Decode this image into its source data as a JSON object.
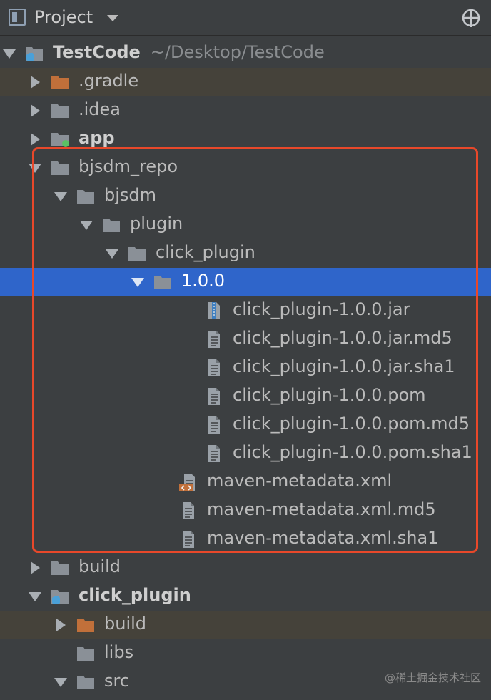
{
  "toolbar": {
    "title": "Project"
  },
  "tree": [
    {
      "label": "TestCode",
      "path": "~/Desktop/TestCode",
      "icon": "module-folder-icon",
      "arrow": "down",
      "bold": true
    },
    {
      "label": ".gradle",
      "icon": "folder-orange-icon",
      "arrow": "right",
      "highlight": true
    },
    {
      "label": ".idea",
      "icon": "folder-icon",
      "arrow": "right"
    },
    {
      "label": "app",
      "icon": "android-module-folder-icon",
      "arrow": "right",
      "bold": true
    },
    {
      "label": "bjsdm_repo",
      "icon": "folder-icon",
      "arrow": "down"
    },
    {
      "label": "bjsdm",
      "icon": "folder-icon",
      "arrow": "down"
    },
    {
      "label": "plugin",
      "icon": "folder-icon",
      "arrow": "down"
    },
    {
      "label": "click_plugin",
      "icon": "folder-icon",
      "arrow": "down"
    },
    {
      "label": "1.0.0",
      "icon": "folder-icon",
      "arrow": "down",
      "selected": true
    },
    {
      "label": "click_plugin-1.0.0.jar",
      "icon": "archive-file-icon"
    },
    {
      "label": "click_plugin-1.0.0.jar.md5",
      "icon": "text-file-icon"
    },
    {
      "label": "click_plugin-1.0.0.jar.sha1",
      "icon": "text-file-icon"
    },
    {
      "label": "click_plugin-1.0.0.pom",
      "icon": "text-file-icon"
    },
    {
      "label": "click_plugin-1.0.0.pom.md5",
      "icon": "text-file-icon"
    },
    {
      "label": "click_plugin-1.0.0.pom.sha1",
      "icon": "text-file-icon"
    },
    {
      "label": "maven-metadata.xml",
      "icon": "xml-file-icon"
    },
    {
      "label": "maven-metadata.xml.md5",
      "icon": "text-file-icon"
    },
    {
      "label": "maven-metadata.xml.sha1",
      "icon": "text-file-icon"
    },
    {
      "label": "build",
      "icon": "folder-icon",
      "arrow": "right"
    },
    {
      "label": "click_plugin",
      "icon": "module-folder-icon",
      "arrow": "down",
      "bold": true
    },
    {
      "label": "build",
      "icon": "folder-orange-icon",
      "arrow": "right",
      "highlight": true
    },
    {
      "label": "libs",
      "icon": "folder-icon"
    },
    {
      "label": "src",
      "icon": "folder-icon",
      "arrow": "down"
    }
  ],
  "watermark": "@稀土掘金技术社区",
  "colors": {
    "selection": "#2f65ca",
    "highlight": "#45423a",
    "annotation_box": "#e8482a"
  }
}
